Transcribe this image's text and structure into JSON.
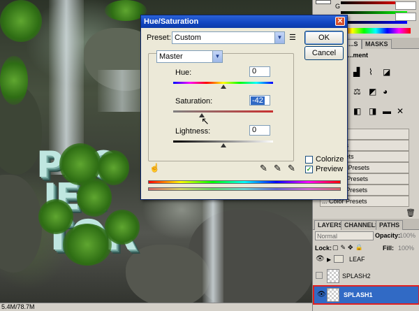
{
  "dialog": {
    "title": "Hue/Saturation",
    "preset_label": "Preset:",
    "preset_value": "Custom",
    "edit_label": "Master",
    "ok_label": "OK",
    "cancel_label": "Cancel",
    "hue_label": "Hue:",
    "hue_value": "0",
    "saturation_label": "Saturation:",
    "saturation_value": "-42",
    "lightness_label": "Lightness:",
    "lightness_value": "0",
    "colorize_label": "Colorize",
    "colorize_checked": false,
    "preview_label": "Preview",
    "preview_checked": true,
    "hue_level": 0,
    "saturation_level": -42,
    "lightness_level": 0
  },
  "canvas": {
    "words": [
      "PRO",
      "JEC",
      "TOR"
    ],
    "status_text": "5.4M/78.7M"
  },
  "color_panel": {
    "g_label": "G"
  },
  "adjustments_panel": {
    "tabs": [
      "...S",
      "MASKS"
    ],
    "title": "...ment",
    "presets": [
      "...esets",
      "...Presets",
      "...e Presets",
      "...uration Presets",
      "... White Presets",
      "... Mixer Presets",
      "... Color Presets"
    ]
  },
  "layers_panel": {
    "tabs": [
      "LAYERS",
      "CHANNELS",
      "PATHS"
    ],
    "blend_mode": "Normal",
    "opacity_label": "Opacity:",
    "opacity_value": "100%",
    "lock_label": "Lock:",
    "fill_label": "Fill:",
    "fill_value": "100%",
    "layers": [
      {
        "name": "LEAF",
        "type": "group"
      },
      {
        "name": "SPLASH2",
        "type": "layer"
      },
      {
        "name": "SPLASH1",
        "type": "layer",
        "selected": true
      }
    ]
  },
  "colors": {
    "titlebar": "#1144c0",
    "selected_layer": "#316ac5",
    "selected_outline": "#e02020"
  }
}
